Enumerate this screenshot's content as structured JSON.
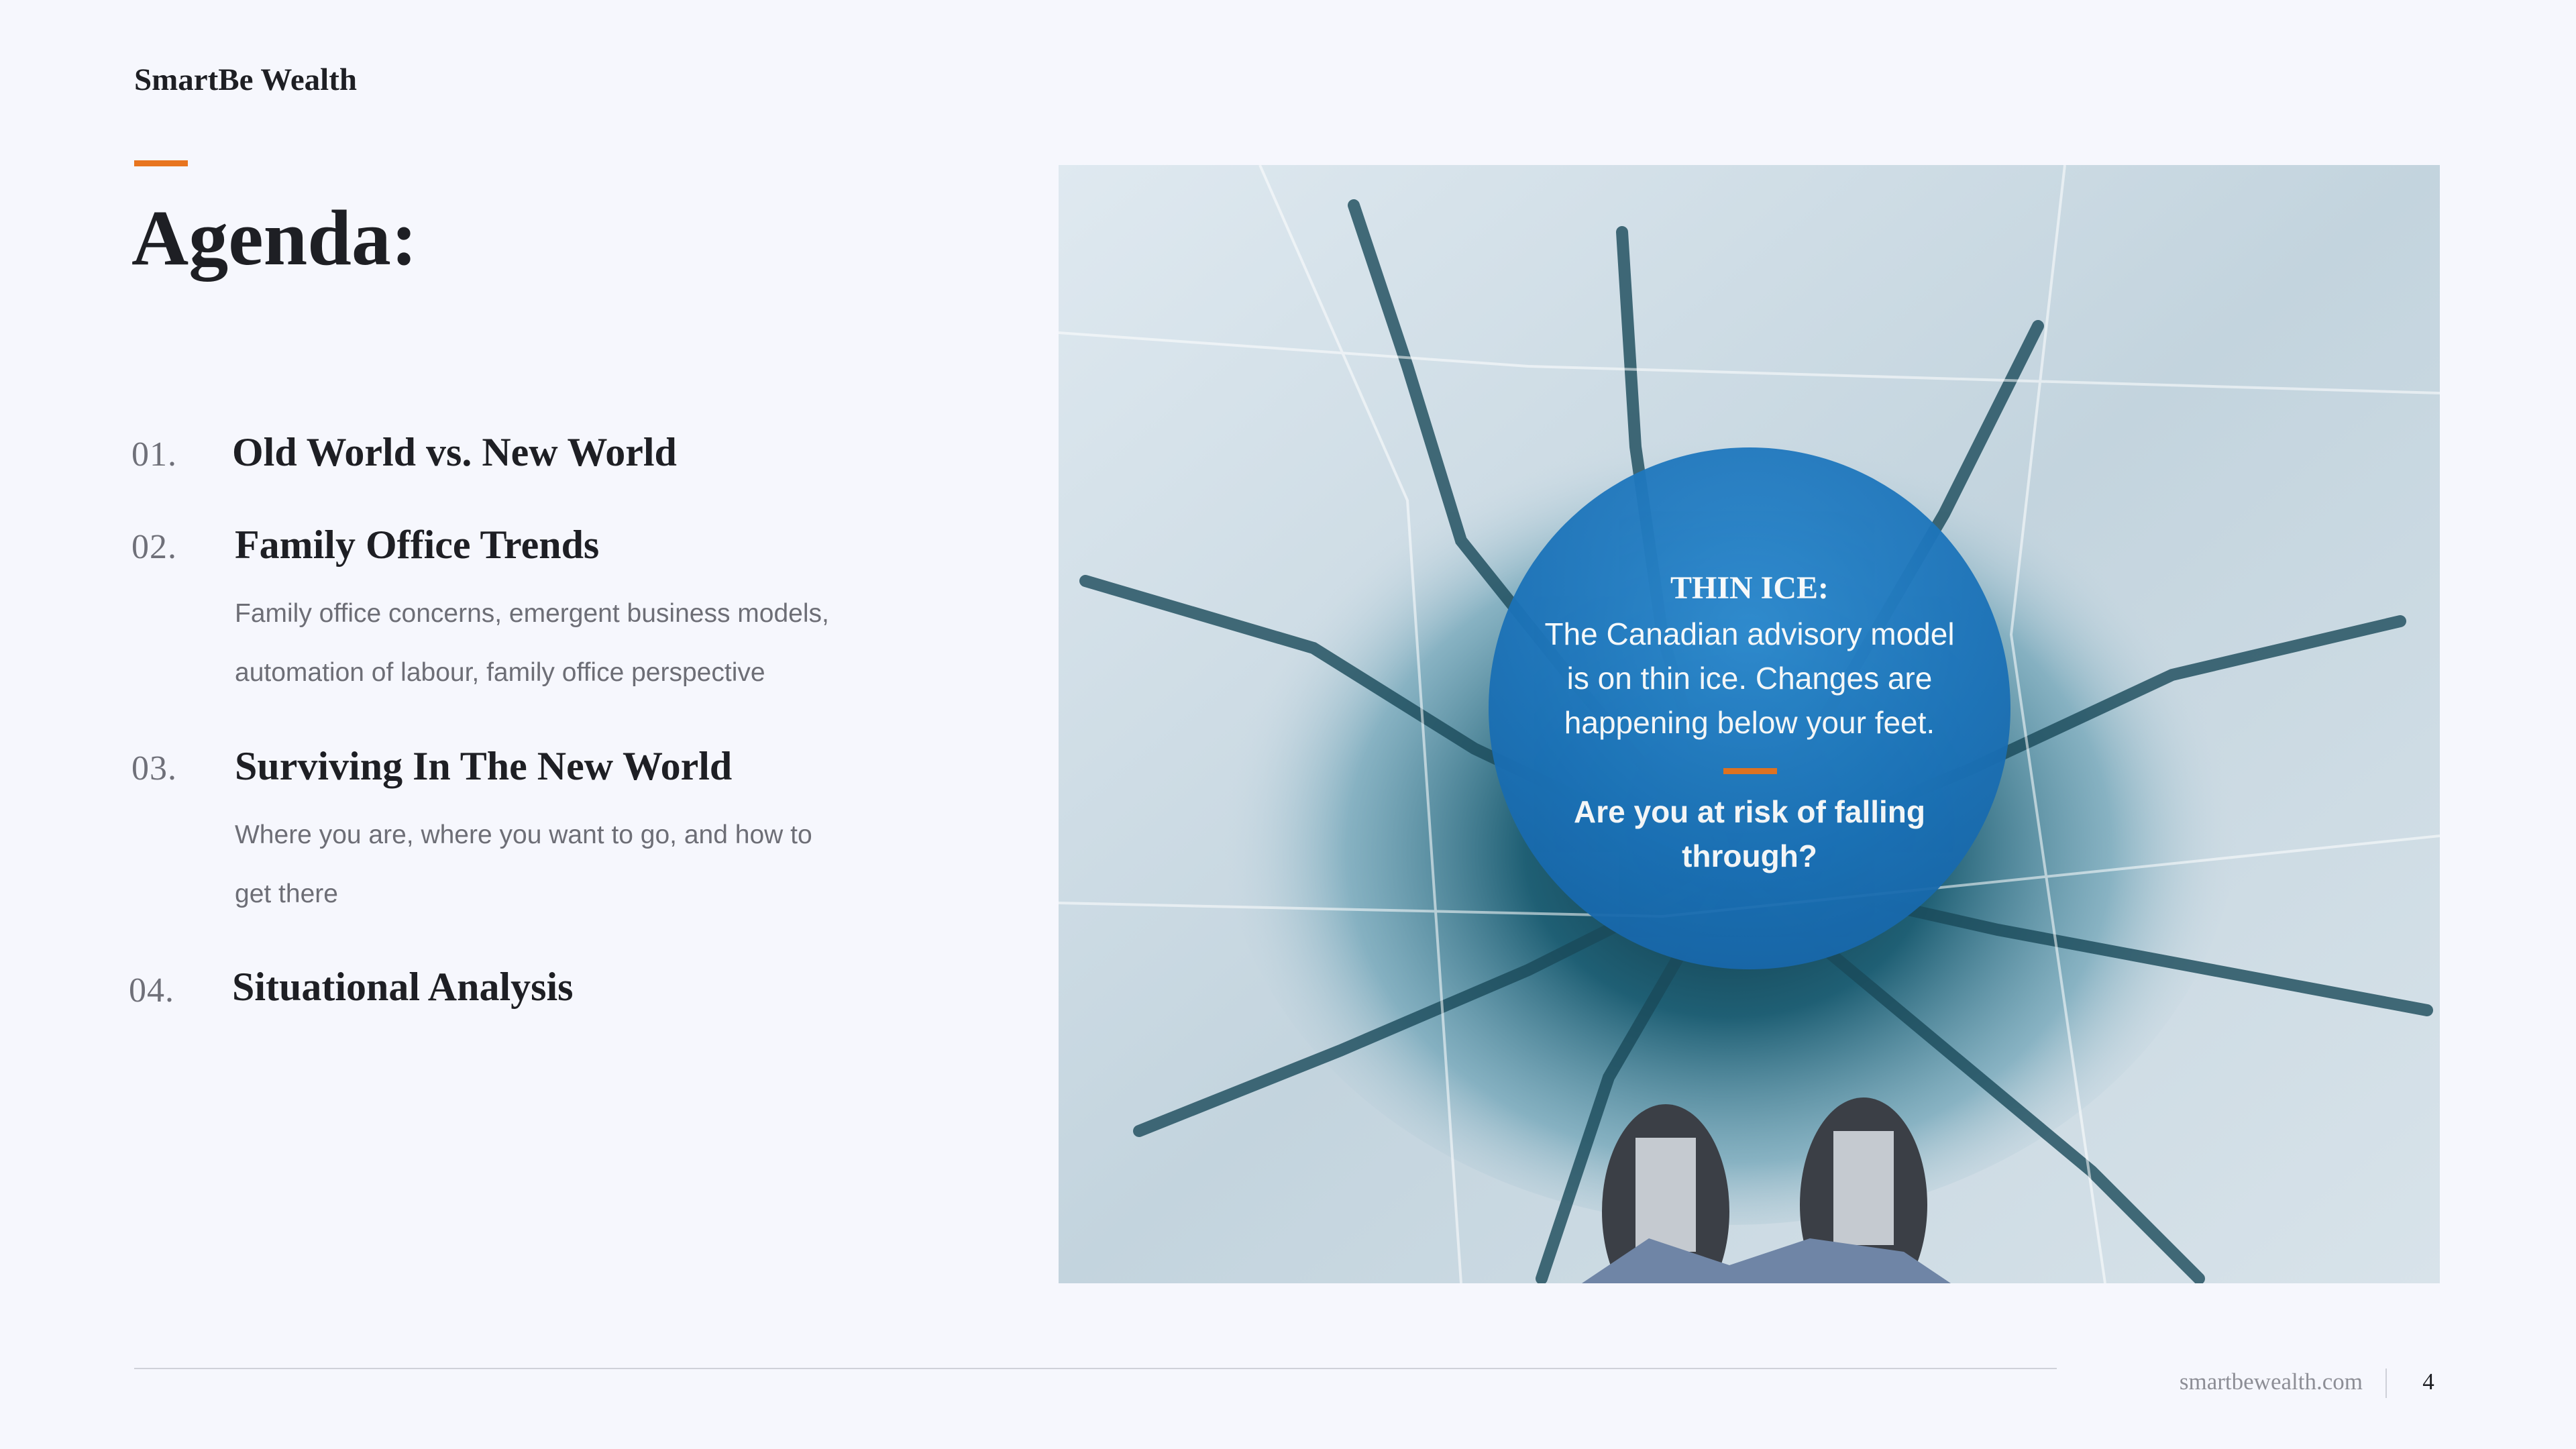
{
  "header": {
    "brand": "SmartBe Wealth"
  },
  "title": "Agenda:",
  "accent_color": "#e8751f",
  "agenda": [
    {
      "number": "01.",
      "heading": "Old World vs. New World",
      "description": ""
    },
    {
      "number": "02.",
      "heading": "Family Office Trends",
      "description": "Family office concerns, emergent business models, automation of labour, family office perspective"
    },
    {
      "number": "03.",
      "heading": "Surviving In The New World",
      "description": "Where you are, where you want to go, and how to get there"
    },
    {
      "number": "04.",
      "heading": "Situational Analysis",
      "description": ""
    }
  ],
  "callout": {
    "title": "THIN ICE:",
    "body": "The Canadian advisory model is on thin ice. Changes are happening below your feet.",
    "question": "Are you at risk of falling through?",
    "color": "#1b72b8"
  },
  "photo": {
    "subject": "cracked-ice-with-skates"
  },
  "footer": {
    "url": "smartbewealth.com",
    "page": "4"
  }
}
